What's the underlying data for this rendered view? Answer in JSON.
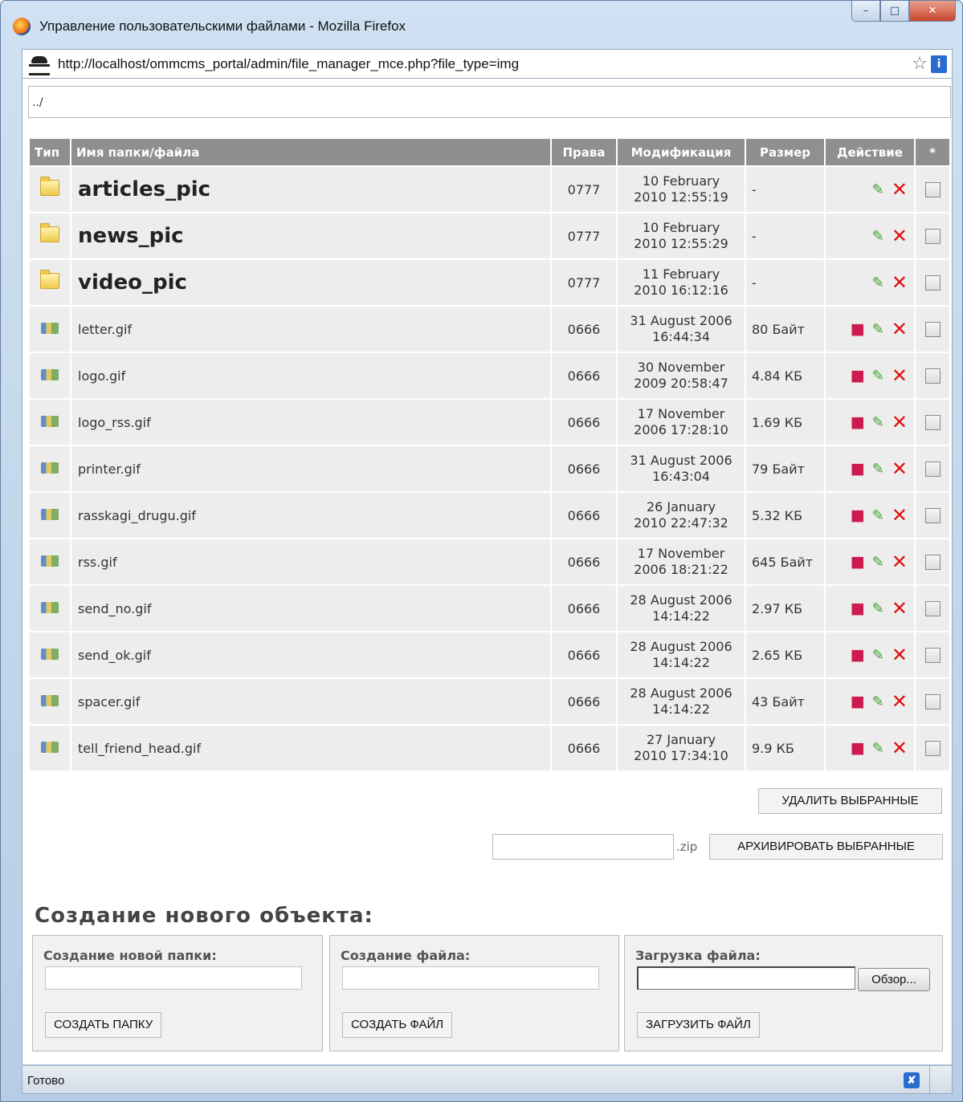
{
  "window": {
    "title": "Управление пользовательскими файлами - Mozilla Firefox"
  },
  "addressbar": {
    "url": "http://localhost/ommcms_portal/admin/file_manager_mce.php?file_type=img"
  },
  "path": "../",
  "table": {
    "headers": {
      "type": "Тип",
      "name": "Имя папки/файла",
      "perm": "Права",
      "mod": "Модификация",
      "size": "Размер",
      "action": "Действие",
      "sel": "*"
    },
    "rows": [
      {
        "kind": "dir",
        "name": "articles_pic",
        "perm": "0777",
        "mod1": "10 February",
        "mod2": "2010 12:55:19",
        "size": "-"
      },
      {
        "kind": "dir",
        "name": "news_pic",
        "perm": "0777",
        "mod1": "10 February",
        "mod2": "2010 12:55:29",
        "size": "-"
      },
      {
        "kind": "dir",
        "name": "video_pic",
        "perm": "0777",
        "mod1": "11 February",
        "mod2": "2010 16:12:16",
        "size": "-"
      },
      {
        "kind": "file",
        "name": "letter.gif",
        "perm": "0666",
        "mod1": "31 August 2006",
        "mod2": "16:44:34",
        "size": "80 Байт"
      },
      {
        "kind": "file",
        "name": "logo.gif",
        "perm": "0666",
        "mod1": "30 November",
        "mod2": "2009 20:58:47",
        "size": "4.84 КБ"
      },
      {
        "kind": "file",
        "name": "logo_rss.gif",
        "perm": "0666",
        "mod1": "17 November",
        "mod2": "2006 17:28:10",
        "size": "1.69 КБ"
      },
      {
        "kind": "file",
        "name": "printer.gif",
        "perm": "0666",
        "mod1": "31 August 2006",
        "mod2": "16:43:04",
        "size": "79 Байт"
      },
      {
        "kind": "file",
        "name": "rasskagi_drugu.gif",
        "perm": "0666",
        "mod1": "26 January",
        "mod2": "2010 22:47:32",
        "size": "5.32 КБ"
      },
      {
        "kind": "file",
        "name": "rss.gif",
        "perm": "0666",
        "mod1": "17 November",
        "mod2": "2006 18:21:22",
        "size": "645 Байт"
      },
      {
        "kind": "file",
        "name": "send_no.gif",
        "perm": "0666",
        "mod1": "28 August 2006",
        "mod2": "14:14:22",
        "size": "2.97 КБ"
      },
      {
        "kind": "file",
        "name": "send_ok.gif",
        "perm": "0666",
        "mod1": "28 August 2006",
        "mod2": "14:14:22",
        "size": "2.65 КБ"
      },
      {
        "kind": "file",
        "name": "spacer.gif",
        "perm": "0666",
        "mod1": "28 August 2006",
        "mod2": "14:14:22",
        "size": "43 Байт"
      },
      {
        "kind": "file",
        "name": "tell_friend_head.gif",
        "perm": "0666",
        "mod1": "27 January",
        "mod2": "2010 17:34:10",
        "size": "9.9 КБ"
      }
    ]
  },
  "buttons": {
    "delete_selected": "УДАЛИТЬ ВЫБРАННЫЕ",
    "archive_selected": "АРХИВИРОВАТЬ ВЫБРАННЫЕ",
    "zip_suffix": ".zip"
  },
  "create": {
    "title": "Создание нового объекта:",
    "folder_label": "Создание новой папки:",
    "folder_button": "СОЗДАТЬ ПАПКУ",
    "file_label": "Создание файла:",
    "file_button": "СОЗДАТЬ ФАЙЛ",
    "upload_label": "Загрузка файла:",
    "browse_button": "Обзор...",
    "upload_button": "ЗАГРУЗИТЬ ФАЙЛ"
  },
  "status": {
    "text": "Готово"
  }
}
